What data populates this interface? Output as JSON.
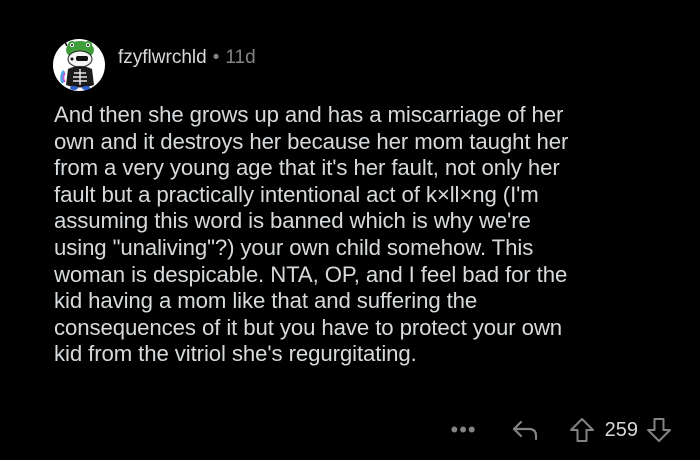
{
  "comment": {
    "author": "fzyflwrchld",
    "separator": "•",
    "age": "11d",
    "body_lines": [
      "And then she grows up and has a miscarriage of her",
      "own and it destroys her because her mom taught her",
      "from a very young age that it's her fault, not only her",
      "fault but a practically intentional act of k×ll×ng (I'm",
      "assuming this word is banned which is why we're",
      "using \"unaliving\"?) your own child somehow. This",
      "woman is despicable. NTA, OP, and I feel bad for the",
      "kid having a mom like that and suffering the",
      "consequences of it but you have to protect your own",
      "kid from the vitriol she's regurgitating."
    ]
  },
  "actions": {
    "more_label": "•••",
    "score": "259"
  },
  "icons": {
    "avatar": "snoo-avatar-icon",
    "reply": "reply-arrow-icon",
    "upvote": "upvote-arrow-icon",
    "downvote": "downvote-arrow-icon"
  },
  "colors": {
    "background": "#000000",
    "text": "#d7dadc",
    "muted": "#818384"
  }
}
